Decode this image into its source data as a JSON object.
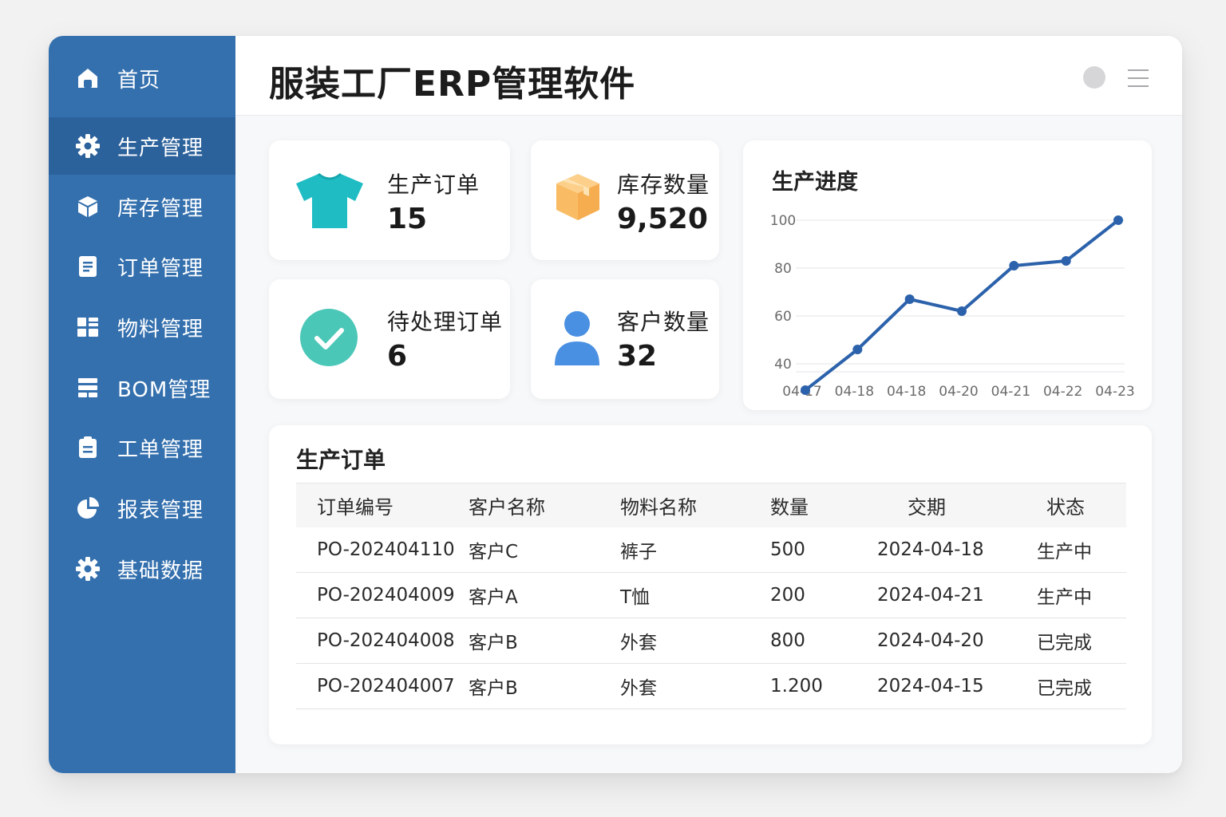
{
  "app": {
    "title": "服装工厂ERP管理软件"
  },
  "sidebar": {
    "items": [
      {
        "label": "首页",
        "icon": "home-icon"
      },
      {
        "label": "生产管理",
        "icon": "gear-icon"
      },
      {
        "label": "库存管理",
        "icon": "box-icon"
      },
      {
        "label": "订单管理",
        "icon": "document-icon"
      },
      {
        "label": "物料管理",
        "icon": "grid-icon"
      },
      {
        "label": "BOM管理",
        "icon": "layout-icon"
      },
      {
        "label": "工单管理",
        "icon": "clipboard-icon"
      },
      {
        "label": "报表管理",
        "icon": "pie-chart-icon"
      },
      {
        "label": "基础数据",
        "icon": "gear-icon"
      }
    ],
    "active_index": 1,
    "bg_color": "#3470ae"
  },
  "stats": [
    {
      "label": "生产订单",
      "value": "15",
      "icon": "tshirt-icon",
      "color": "#1fbcc4"
    },
    {
      "label": "库存数量",
      "value": "9,520",
      "icon": "box-icon",
      "color": "#f9bc64"
    },
    {
      "label": "待处理订单",
      "value": "6",
      "icon": "check-circle-icon",
      "color": "#4bc7b8"
    },
    {
      "label": "客户数量",
      "value": "32",
      "icon": "user-icon",
      "color": "#4a90e2"
    }
  ],
  "chart_data": {
    "type": "line",
    "title": "生产进度",
    "categories": [
      "04-17",
      "04-18",
      "04-18",
      "04-20",
      "04-21",
      "04-22",
      "04-23"
    ],
    "series": [
      {
        "values": [
          29,
          46,
          67,
          62,
          81,
          83,
          100
        ]
      }
    ],
    "yticks": [
      100,
      80,
      60,
      40
    ],
    "ylim": [
      24,
      100
    ],
    "xlabel": "",
    "ylabel": "",
    "grid": true,
    "line_color": "#2c62ab"
  },
  "orders_table": {
    "title": "生产订单",
    "columns": [
      "订单编号",
      "客户名称",
      "物料名称",
      "数量",
      "交期",
      "状态"
    ],
    "rows": [
      [
        "PO-202404110",
        "客户C",
        "裤子",
        "500",
        "2024-04-18",
        "生产中"
      ],
      [
        "PO-202404009",
        "客户A",
        "T恤",
        "200",
        "2024-04-21",
        "生产中"
      ],
      [
        "PO-202404008",
        "客户B",
        "外套",
        "800",
        "2024-04-20",
        "已完成"
      ],
      [
        "PO-202404007",
        "客户B",
        "外套",
        "1.200",
        "2024-04-15",
        "已完成"
      ]
    ]
  }
}
